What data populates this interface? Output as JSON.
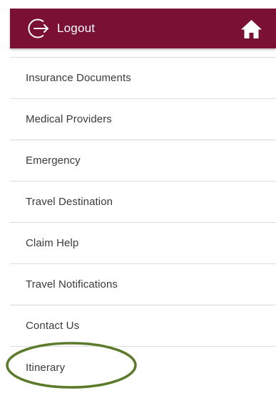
{
  "header": {
    "logout_label": "Logout",
    "logout_icon": "logout-arrow-circle-icon",
    "home_icon": "home-icon",
    "background_color": "#7a1034"
  },
  "menu": {
    "items": [
      {
        "label": "Insurance Documents"
      },
      {
        "label": "Medical Providers"
      },
      {
        "label": "Emergency"
      },
      {
        "label": "Travel Destination"
      },
      {
        "label": "Claim Help"
      },
      {
        "label": "Travel Notifications"
      },
      {
        "label": "Contact Us"
      },
      {
        "label": "Itinerary"
      }
    ]
  },
  "annotation": {
    "highlight_color": "#5b7a2a"
  }
}
